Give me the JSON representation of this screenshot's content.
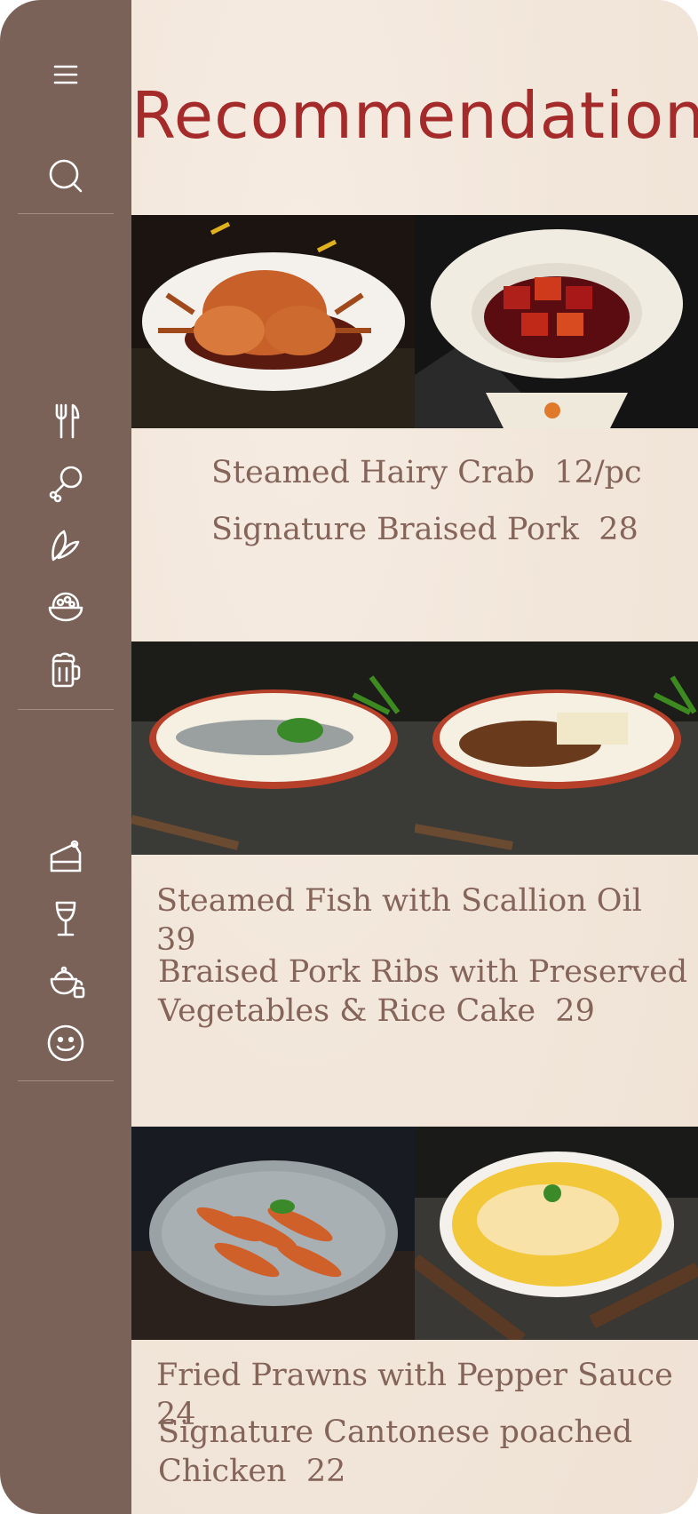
{
  "page": {
    "title": "Recommendation"
  },
  "sidebar": {
    "icons": [
      {
        "name": "menu-icon"
      },
      {
        "name": "search-icon"
      },
      {
        "name": "utensils-icon"
      },
      {
        "name": "drumstick-icon"
      },
      {
        "name": "leaf-icon"
      },
      {
        "name": "bowl-icon"
      },
      {
        "name": "beer-mug-icon"
      },
      {
        "name": "cake-slice-icon"
      },
      {
        "name": "wine-glass-icon"
      },
      {
        "name": "teapot-icon"
      },
      {
        "name": "smiley-icon"
      }
    ]
  },
  "sections": [
    {
      "items": [
        {
          "text": "Steamed Hairy Crab  12/pc"
        },
        {
          "text": "Signature Braised Pork  28"
        }
      ]
    },
    {
      "items": [
        {
          "text": "Steamed Fish with Scallion Oil  39"
        },
        {
          "text": "Braised Pork Ribs with Preserved\nVegetables & Rice Cake  29"
        }
      ]
    },
    {
      "items": [
        {
          "text": "Fried Prawns with Pepper Sauce  24"
        },
        {
          "text": "Signature Cantonese poached\nChicken  22"
        }
      ]
    }
  ],
  "colors": {
    "sidebar": "#7a6258",
    "title": "#a52a2a",
    "item_text": "#85645a",
    "background": "#f3e8dc"
  }
}
